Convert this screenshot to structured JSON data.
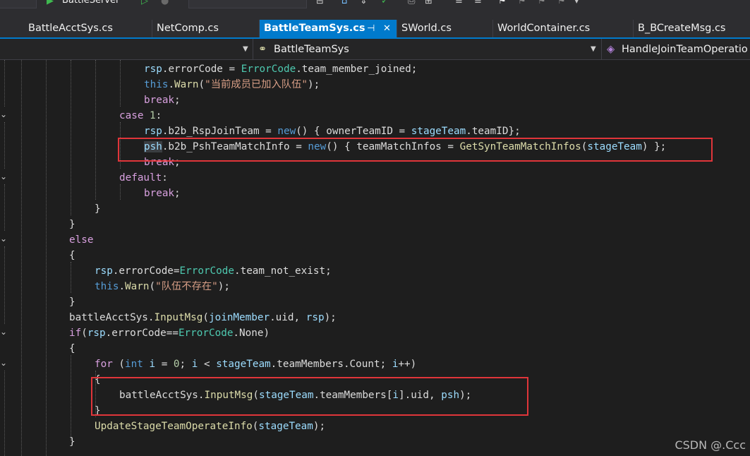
{
  "toolbar": {
    "run_target": "BattleServer",
    "colors": {
      "run_green": "#3fb950",
      "icon": "#c8c8c8"
    }
  },
  "tabs": [
    {
      "label": "BattleAcctSys.cs"
    },
    {
      "label": "NetComp.cs"
    },
    {
      "label": "BattleTeamSys.cs",
      "active": true,
      "pin_icon": "⊣",
      "close_icon": "✕"
    },
    {
      "label": "SWorld.cs"
    },
    {
      "label": "WorldContainer.cs"
    },
    {
      "label": "B_BCreateMsg.cs"
    }
  ],
  "navbar": {
    "class_name": "BattleTeamSys",
    "member_name": "HandleJoinTeamOperatio"
  },
  "code_lines": [
    [
      [
        "var",
        "rsp"
      ],
      [
        "plain",
        "."
      ],
      [
        "plain",
        "errorCode = "
      ],
      [
        "type",
        "ErrorCode"
      ],
      [
        "plain",
        ".team_member_joined;"
      ]
    ],
    [
      [
        "kw",
        "this"
      ],
      [
        "plain",
        "."
      ],
      [
        "meth",
        "Warn"
      ],
      [
        "plain",
        "("
      ],
      [
        "str",
        "\"当前成员已加入队伍\""
      ],
      [
        "plain",
        ");"
      ]
    ],
    [
      [
        "ctl",
        "break"
      ],
      [
        "plain",
        ";"
      ]
    ],
    [
      [
        "ctl",
        "case"
      ],
      [
        "plain",
        " "
      ],
      [
        "num",
        "1"
      ],
      [
        "plain",
        ":"
      ]
    ],
    [
      [
        "var",
        "rsp"
      ],
      [
        "plain",
        ".b2b_RspJoinTeam = "
      ],
      [
        "kw",
        "new"
      ],
      [
        "plain",
        "() { ownerTeamID = "
      ],
      [
        "var",
        "stageTeam"
      ],
      [
        "plain",
        ".teamID};"
      ]
    ],
    [
      [
        "var",
        "psh"
      ],
      [
        "plain",
        ".b2b_PshTeamMatchInfo = "
      ],
      [
        "kw",
        "new"
      ],
      [
        "plain",
        "() { teamMatchInfos = "
      ],
      [
        "meth",
        "GetSynTeamMatchInfos"
      ],
      [
        "plain",
        "("
      ],
      [
        "var",
        "stageTeam"
      ],
      [
        "plain",
        ") };"
      ]
    ],
    [
      [
        "ctl",
        "break"
      ],
      [
        "plain",
        ";"
      ]
    ],
    [
      [
        "ctl",
        "default"
      ],
      [
        "plain",
        ":"
      ]
    ],
    [
      [
        "ctl",
        "break"
      ],
      [
        "plain",
        ";"
      ]
    ],
    [
      [
        "plain",
        "}"
      ]
    ],
    [
      [
        "plain",
        "}"
      ]
    ],
    [
      [
        "ctl",
        "else"
      ]
    ],
    [
      [
        "plain",
        "{"
      ]
    ],
    [
      [
        "var",
        "rsp"
      ],
      [
        "plain",
        ".errorCode="
      ],
      [
        "type",
        "ErrorCode"
      ],
      [
        "plain",
        ".team_not_exist;"
      ]
    ],
    [
      [
        "kw",
        "this"
      ],
      [
        "plain",
        "."
      ],
      [
        "meth",
        "Warn"
      ],
      [
        "plain",
        "("
      ],
      [
        "str",
        "\"队伍不存在\""
      ],
      [
        "plain",
        ");"
      ]
    ],
    [
      [
        "plain",
        "}"
      ]
    ],
    [
      [
        "plain",
        "battleAcctSys."
      ],
      [
        "meth",
        "InputMsg"
      ],
      [
        "plain",
        "("
      ],
      [
        "var",
        "joinMember"
      ],
      [
        "plain",
        ".uid, "
      ],
      [
        "var",
        "rsp"
      ],
      [
        "plain",
        ");"
      ]
    ],
    [
      [
        "ctl",
        "if"
      ],
      [
        "plain",
        "("
      ],
      [
        "var",
        "rsp"
      ],
      [
        "plain",
        ".errorCode=="
      ],
      [
        "type",
        "ErrorCode"
      ],
      [
        "plain",
        ".None)"
      ]
    ],
    [
      [
        "plain",
        "{"
      ]
    ],
    [
      [
        "ctl",
        "for"
      ],
      [
        "plain",
        " ("
      ],
      [
        "kw",
        "int"
      ],
      [
        "plain",
        " "
      ],
      [
        "var",
        "i"
      ],
      [
        "plain",
        " = "
      ],
      [
        "num",
        "0"
      ],
      [
        "plain",
        "; "
      ],
      [
        "var",
        "i"
      ],
      [
        "plain",
        " < "
      ],
      [
        "var",
        "stageTeam"
      ],
      [
        "plain",
        ".teamMembers.Count; "
      ],
      [
        "var",
        "i"
      ],
      [
        "plain",
        "++)"
      ]
    ],
    [
      [
        "plain",
        "{"
      ]
    ],
    [
      [
        "plain",
        "battleAcctSys."
      ],
      [
        "meth",
        "InputMsg"
      ],
      [
        "plain",
        "("
      ],
      [
        "var",
        "stageTeam"
      ],
      [
        "plain",
        ".teamMembers["
      ],
      [
        "var",
        "i"
      ],
      [
        "plain",
        "].uid, "
      ],
      [
        "var",
        "psh"
      ],
      [
        "plain",
        ");"
      ]
    ],
    [
      [
        "plain",
        "}"
      ]
    ],
    [
      [
        "meth",
        "UpdateStageTeamOperateInfo"
      ],
      [
        "plain",
        "("
      ],
      [
        "var",
        "stageTeam"
      ],
      [
        "plain",
        ");"
      ]
    ],
    [
      [
        "plain",
        "}"
      ]
    ]
  ],
  "colors": {
    "keyword": "#569cd6",
    "control": "#d8a0df",
    "variable": "#9cdcfe",
    "type": "#4ec9b0",
    "method": "#dcdcaa",
    "string": "#d69d85",
    "number": "#b5cea8",
    "annotation_box": "#e0353a"
  },
  "watermark": "CSDN @.Ccc"
}
